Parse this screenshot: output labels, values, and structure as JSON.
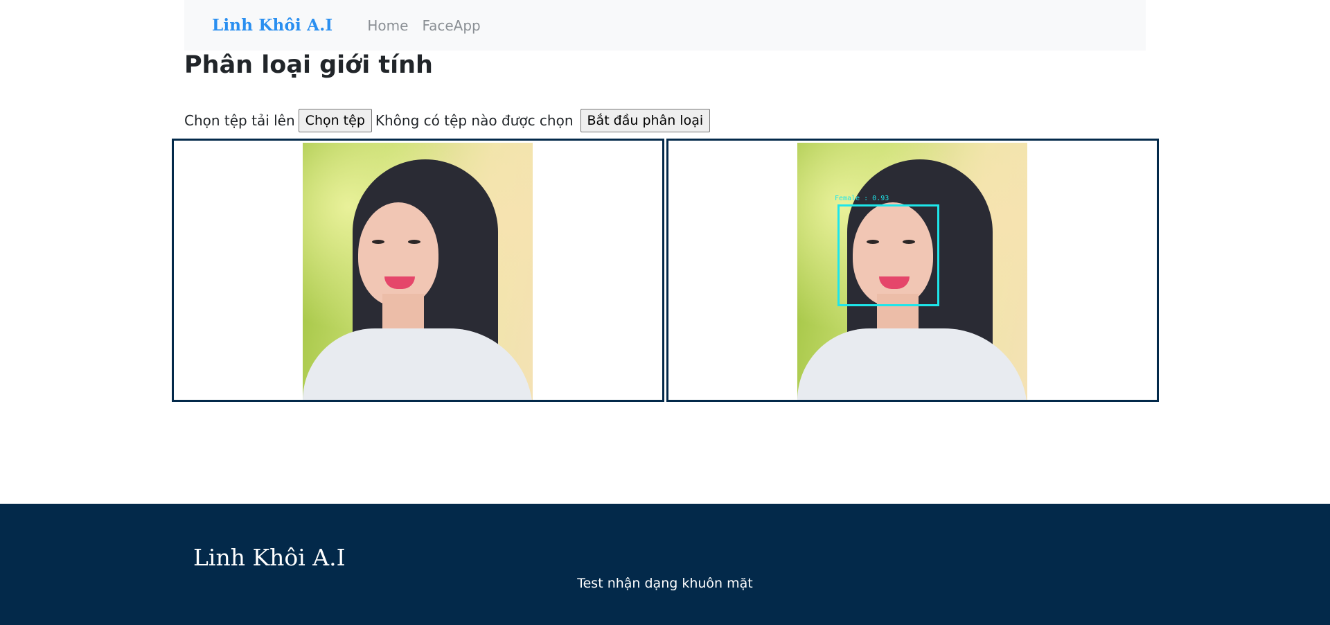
{
  "navbar": {
    "brand": "Linh Khôi A.I",
    "links": [
      {
        "label": "Home"
      },
      {
        "label": "FaceApp"
      }
    ]
  },
  "main": {
    "title": "Phân loại giới tính",
    "upload_label": "Chọn tệp tải lên",
    "choose_file_button": "Chọn tệp",
    "no_file_text": "Không có tệp nào được chọn",
    "submit_button": "Bắt đầu phân loại"
  },
  "result": {
    "detection_label": "Female : 0.93",
    "box_color": "#1ee6ea"
  },
  "footer": {
    "brand": "Linh Khôi A.I",
    "tagline": "Test nhận dạng khuôn mặt"
  },
  "colors": {
    "brand": "#2a8ff0",
    "navy": "#03294a",
    "navbar_bg": "#f8f9fa"
  }
}
